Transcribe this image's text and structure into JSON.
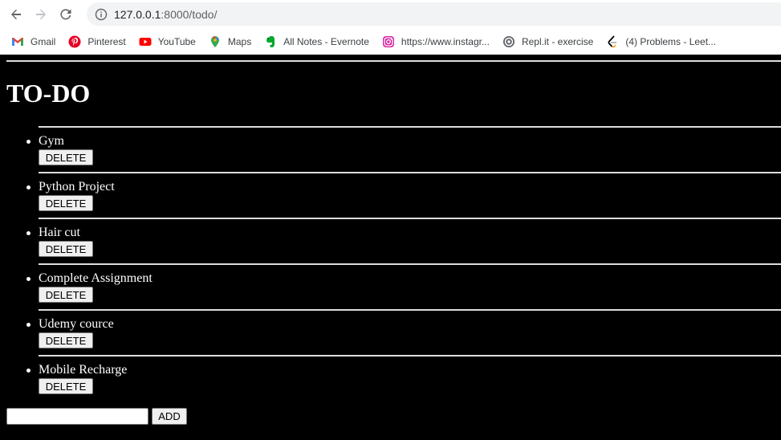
{
  "browser": {
    "url_host": "127.0.0.1",
    "url_rest": ":8000/todo/"
  },
  "bookmarks": [
    {
      "label": "Gmail",
      "icon": "gmail-icon"
    },
    {
      "label": "Pinterest",
      "icon": "pinterest-icon"
    },
    {
      "label": "YouTube",
      "icon": "youtube-icon"
    },
    {
      "label": "Maps",
      "icon": "maps-icon"
    },
    {
      "label": "All Notes - Evernote",
      "icon": "evernote-icon"
    },
    {
      "label": "https://www.instagr...",
      "icon": "instagram-icon"
    },
    {
      "label": "Repl.it - exercise",
      "icon": "replit-icon"
    },
    {
      "label": "(4) Problems - Leet...",
      "icon": "leetcode-icon"
    }
  ],
  "page": {
    "title": "TO-DO",
    "delete_label": "DELETE",
    "add_label": "ADD",
    "input_value": "",
    "items": [
      {
        "label": "Gym"
      },
      {
        "label": "Python Project"
      },
      {
        "label": "Hair cut"
      },
      {
        "label": "Complete Assignment"
      },
      {
        "label": "Udemy cource"
      },
      {
        "label": "Mobile Recharge"
      }
    ]
  }
}
